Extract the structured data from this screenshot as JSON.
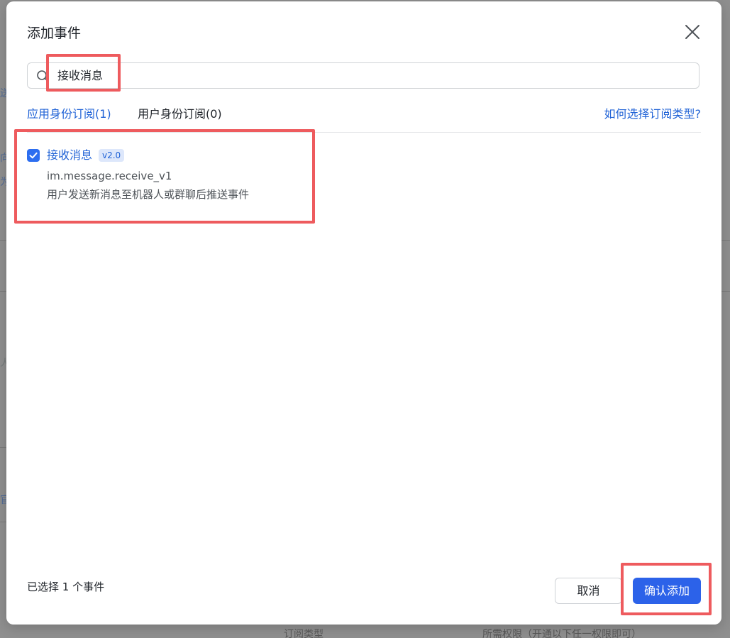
{
  "background": {
    "fragments": [
      "送",
      "为",
      "向",
      "人",
      "官",
      "订阅类型",
      "所需权限（开通以下任一权限即可）"
    ]
  },
  "modal": {
    "title": "添加事件",
    "close_icon": "close-icon",
    "search": {
      "value": "接收消息",
      "icon": "search-icon"
    },
    "tabs": [
      {
        "label": "应用身份订阅(1)",
        "active": true
      },
      {
        "label": "用户身份订阅(0)",
        "active": false
      }
    ],
    "help_link": "如何选择订阅类型?",
    "events": [
      {
        "name": "接收消息",
        "version": "v2.0",
        "key": "im.message.receive_v1",
        "description": "用户发送新消息至机器人或群聊后推送事件",
        "checked": true
      }
    ],
    "footer": {
      "selected_text": "已选择 1 个事件",
      "cancel_label": "取消",
      "confirm_label": "确认添加"
    }
  },
  "colors": {
    "accent": "#2c62e9",
    "link": "#1f62d6",
    "highlight": "#ee5b5e",
    "overlay": "#8f8f8f"
  }
}
